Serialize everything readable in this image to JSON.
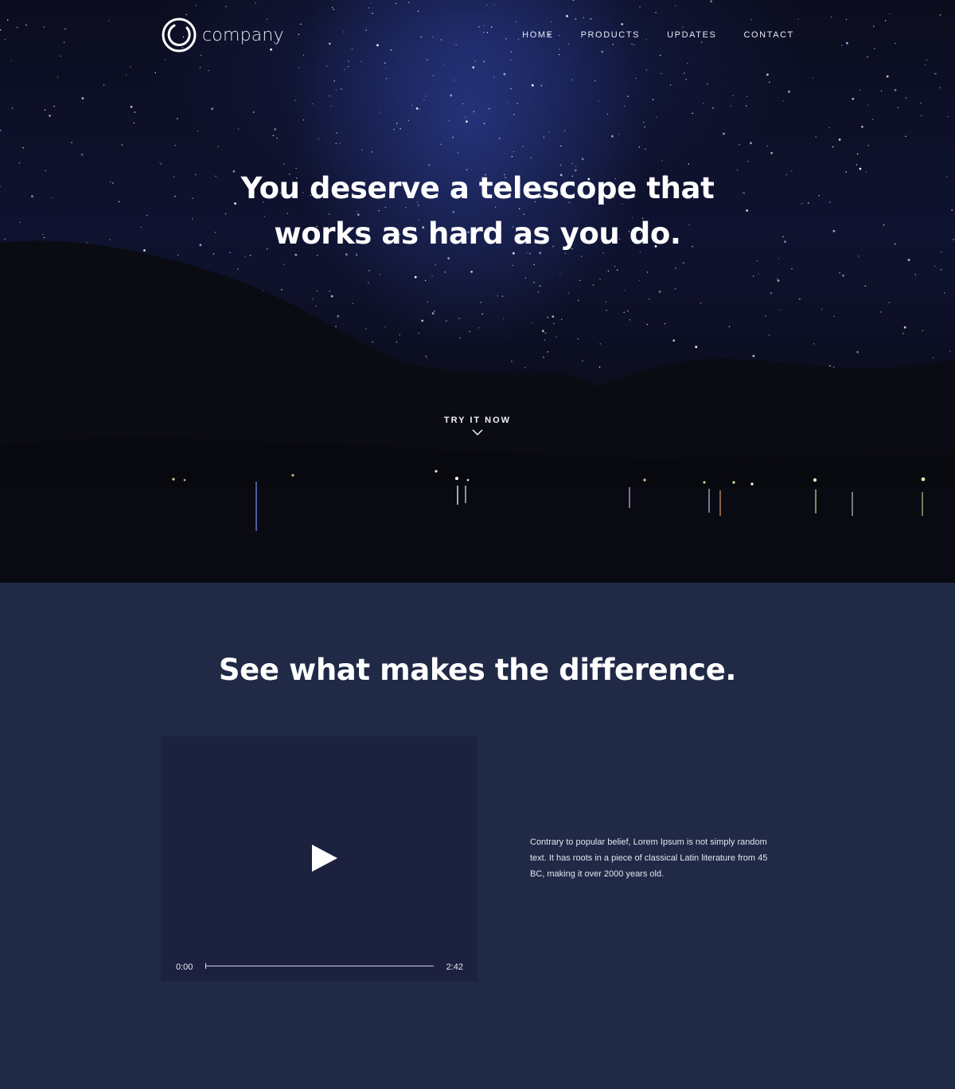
{
  "brand": {
    "name": "company"
  },
  "nav": {
    "items": [
      {
        "label": "HOME"
      },
      {
        "label": "PRODUCTS"
      },
      {
        "label": "UPDATES"
      },
      {
        "label": "CONTACT"
      }
    ]
  },
  "hero": {
    "headline_line1": "You deserve a telescope that",
    "headline_line2": "works as hard as you do.",
    "cta_label": "TRY IT NOW"
  },
  "feature": {
    "title": "See what makes the difference.",
    "video": {
      "current_time": "0:00",
      "duration": "2:42",
      "progress": 0
    },
    "description": "Contrary to popular belief, Lorem Ipsum is not simply random text. It has roots in a piece of classical Latin literature from 45 BC, making it over 2000 years old."
  },
  "colors": {
    "hero_sky": "#0f1330",
    "section_bg": "#202946",
    "video_bg": "#1c2140",
    "text": "#ffffff"
  }
}
